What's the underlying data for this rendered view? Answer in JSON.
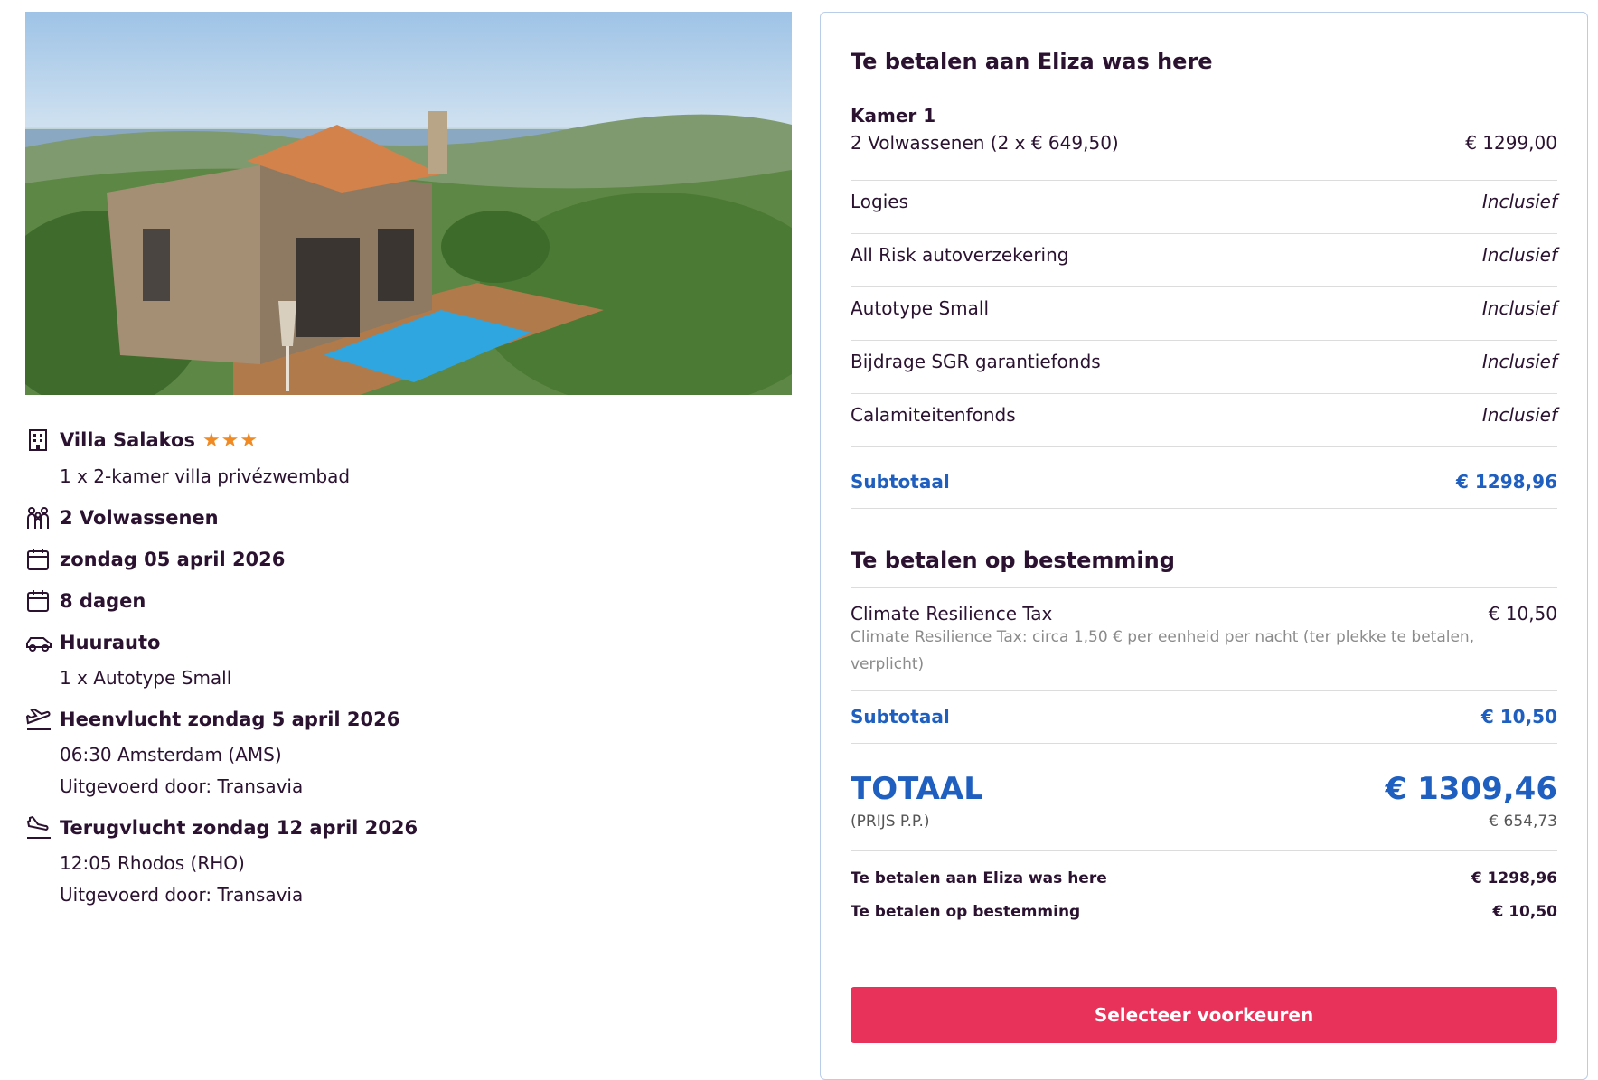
{
  "hotel": {
    "name": "Villa Salakos",
    "stars": "★★★",
    "room": "1 x 2-kamer villa privézwembad"
  },
  "travelers": "2 Volwassenen",
  "date": "zondag 05 april 2026",
  "duration": "8 dagen",
  "car": {
    "title": "Huurauto",
    "detail": "1 x Autotype Small"
  },
  "outbound": {
    "title": "Heenvlucht zondag 5 april 2026",
    "time": "06:30 Amsterdam (AMS)",
    "carrier": "Uitgevoerd door: Transavia"
  },
  "return": {
    "title": "Terugvlucht zondag 12 april 2026",
    "time": "12:05 Rhodos (RHO)",
    "carrier": "Uitgevoerd door: Transavia"
  },
  "panel": {
    "pay_agency_title": "Te betalen aan Eliza was here",
    "room_label": "Kamer 1",
    "adults_label": "2 Volwassenen (2 x € 649,50)",
    "adults_price": "€ 1299,00",
    "included_items": [
      {
        "label": "Logies",
        "value": "Inclusief"
      },
      {
        "label": "All Risk autoverzekering",
        "value": "Inclusief"
      },
      {
        "label": "Autotype Small",
        "value": "Inclusief"
      },
      {
        "label": "Bijdrage SGR garantiefonds",
        "value": "Inclusief"
      },
      {
        "label": "Calamiteitenfonds",
        "value": "Inclusief"
      }
    ],
    "subtotal_label": "Subtotaal",
    "subtotal_agency": "€ 1298,96",
    "pay_destination_title": "Te betalen op bestemming",
    "tax_label": "Climate Resilience Tax",
    "tax_price": "€ 10,50",
    "tax_note": "Climate Resilience Tax: circa 1,50 € per eenheid per nacht (ter plekke te betalen, verplicht)",
    "subtotal_destination": "€ 10,50",
    "total_label": "TOTAAL",
    "total_price": "€ 1309,46",
    "pp_label": "(PRIJS P.P.)",
    "pp_price": "€ 654,73",
    "summary_agency_label": "Te betalen aan Eliza was here",
    "summary_agency_value": "€ 1298,96",
    "summary_destination_label": "Te betalen op bestemming",
    "summary_destination_value": "€ 10,50",
    "cta_label": "Selecteer voorkeuren"
  }
}
